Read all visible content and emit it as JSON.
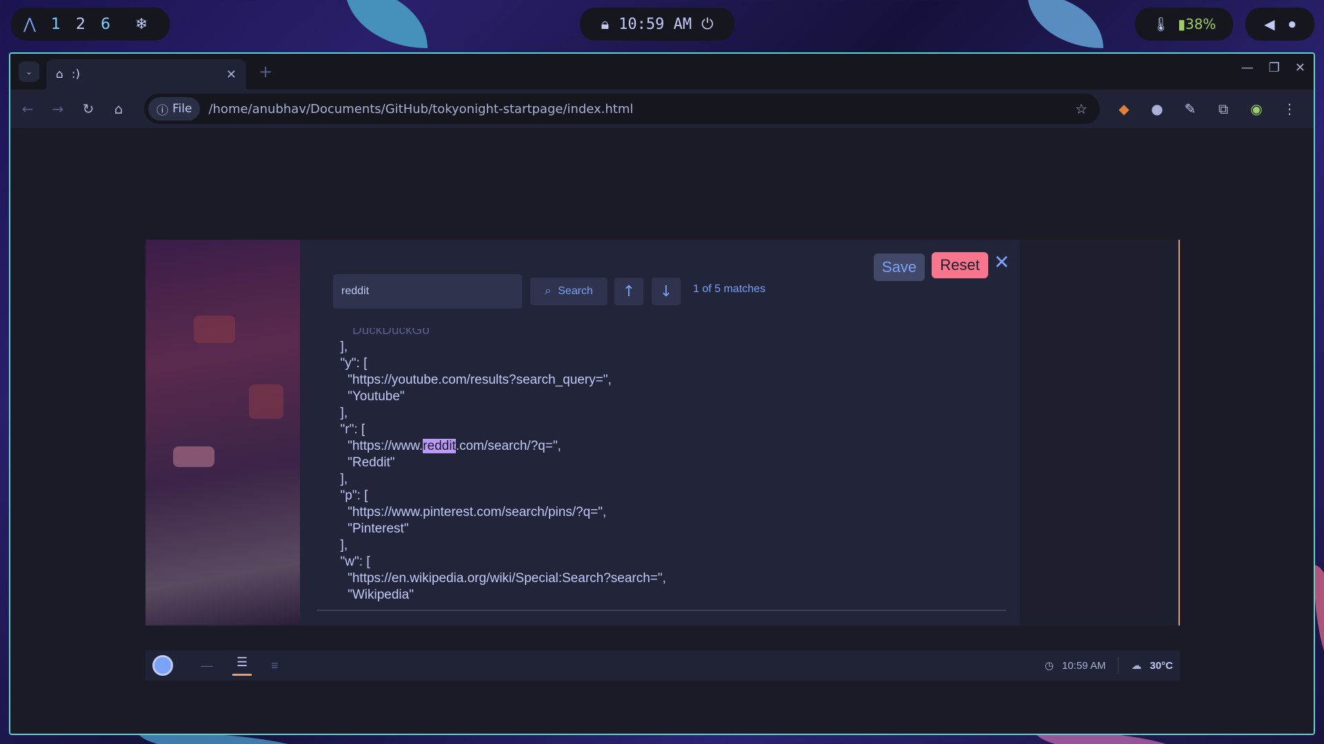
{
  "topbar": {
    "workspaces": [
      "1",
      "2",
      "6"
    ],
    "clock": "10:59 AM",
    "battery": "38%"
  },
  "browser": {
    "tab_title": ":)",
    "omnibox_chip": "File",
    "url": "/home/anubhav/Documents/GitHub/tokyonight-startpage/index.html"
  },
  "editor": {
    "save_label": "Save",
    "reset_label": "Reset",
    "search_value": "reddit",
    "search_label": "Search",
    "matches": "1 of 5 matches",
    "lines": {
      "l0": "    \"DuckDuckGo\"",
      "l1": "  ],",
      "l2": "  \"y\": [",
      "l3": "    \"https://youtube.com/results?search_query=\",",
      "l4": "    \"Youtube\"",
      "l5": "  ],",
      "l6": "  \"r\": [",
      "l7a": "    \"https://www.",
      "l7b": "reddit",
      "l7c": ".com/search/?q=\",",
      "l8": "    \"Reddit\"",
      "l9": "  ],",
      "l10": "  \"p\": [",
      "l11": "    \"https://www.pinterest.com/search/pins/?q=\",",
      "l12": "    \"Pinterest\"",
      "l13": "  ],",
      "l14": "  \"w\": [",
      "l15": "    \"https://en.wikipedia.org/wiki/Special:Search?search=\",",
      "l16": "    \"Wikipedia\""
    }
  },
  "bottombar": {
    "time": "10:59 AM",
    "temperature": "30°C"
  },
  "colors": {
    "accent": "#7aa2f7",
    "reset": "#f7768e",
    "highlight": "#bb9af7",
    "window_border": "#5fd7d0"
  }
}
